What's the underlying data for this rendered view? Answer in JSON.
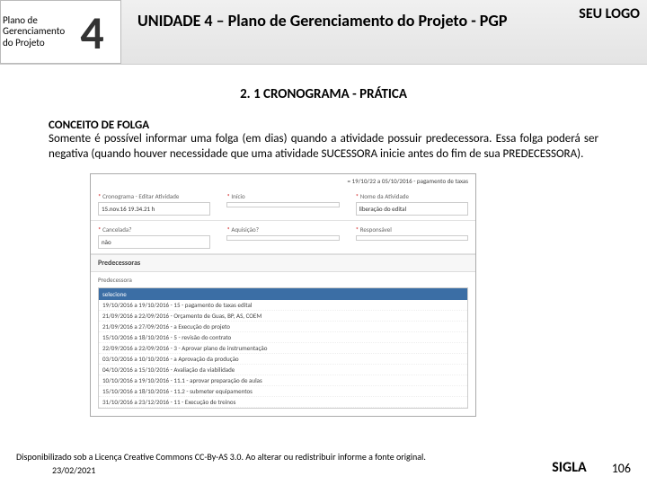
{
  "header": {
    "unit_label": "Plano de Gerenciamento do Projeto",
    "unit_number": "4",
    "title": "UNIDADE 4 – Plano de Gerenciamento do Projeto - PGP",
    "logo": "SEU LOGO"
  },
  "section_title": "2. 1 CRONOGRAMA - PRÁTICA",
  "concept": {
    "title": "CONCEITO DE FOLGA",
    "body": "Somente é possível informar uma folga (em dias) quando a atividade possuir predecessora. Essa folga poderá ser negativa (quando houver necessidade que uma atividade SUCESSORA inicie antes do fim de sua PREDECESSORA)."
  },
  "form": {
    "top_range": "= 19/10/22 a 05/10/2016 - pagamento de taxas",
    "row1": {
      "c1_label": "Cronograma - Editar Atividade",
      "c1_val": "15.nov.16   19.34.21 h",
      "c2_label": "Início",
      "c2_val": "",
      "c3_label": "Nome da Atividade",
      "c3_val": "liberação do edital"
    },
    "row2": {
      "c1_label": "Cancelada?",
      "c1_val": "não",
      "c2_label": "Aquisição?",
      "c2_val": "",
      "c3_label": "Responsável",
      "c3_val": ""
    },
    "pred_header": "Predecessoras",
    "pred_label": "Predecessora",
    "pred_selected": "selecione",
    "pred_options": [
      "19/10/2016 a 19/10/2016 - 15 - pagamento de taxas edital",
      "21/09/2016 a 22/09/2016 - Orçamento de Guas, BP, AS, COEM",
      "21/09/2016 a 27/09/2016 - a Execução do projeto",
      "15/10/2016 a 18/10/2016 - 5 - revisão do contrato",
      "22/09/2016 a 22/09/2016 - 3 - Aprovar plano de instrumentação",
      "03/10/2016 a 10/10/2016 - a Aprovação da produção",
      "04/10/2016 a 15/10/2016 - Avaliação da viabilidade",
      "10/10/2016 a 19/10/2016 - 11.1 - aprovar preparação de aulas",
      "15/10/2016 a 18/10/2016 - 11.2 - submeter equipamentos",
      "31/10/2016 a 23/12/2016 - 11 - Execução de treinos"
    ]
  },
  "footer": {
    "license": "Disponibilizado sob a Licença Creative Commons CC-By-AS 3.0. Ao alterar ou redistribuir informe a fonte original.",
    "date": "23/02/2021",
    "sigla": "SIGLA",
    "page": "106"
  }
}
